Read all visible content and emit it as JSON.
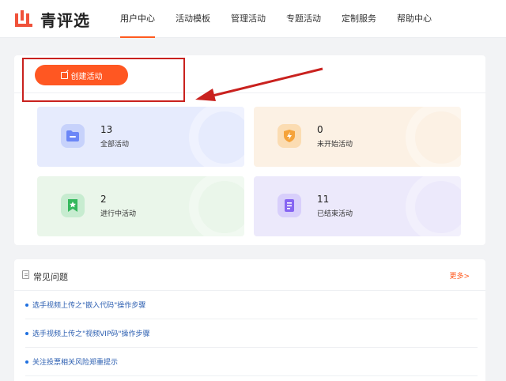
{
  "header": {
    "logo_text": "青评选",
    "nav": [
      "用户中心",
      "活动模板",
      "管理活动",
      "专题活动",
      "定制服务",
      "帮助中心"
    ],
    "active_index": 0,
    "accent_color": "#ff5a1f"
  },
  "create_button": {
    "label": "创建活动"
  },
  "stats": [
    {
      "value": "13",
      "label": "全部活动",
      "icon": "folder-icon",
      "color": "#5b78f6"
    },
    {
      "value": "0",
      "label": "未开始活动",
      "icon": "shield-bolt-icon",
      "color": "#f59a23"
    },
    {
      "value": "2",
      "label": "进行中活动",
      "icon": "star-bookmark-icon",
      "color": "#2fb157"
    },
    {
      "value": "11",
      "label": "已结束活动",
      "icon": "document-icon",
      "color": "#7b5cf0"
    }
  ],
  "faq": {
    "title": "常见问题",
    "more": "更多>",
    "items": [
      "选手视频上传之\"嵌入代码\"操作步骤",
      "选手视频上传之\"视频VIP码\"操作步骤",
      "关注投票相关风险郑重提示"
    ]
  }
}
